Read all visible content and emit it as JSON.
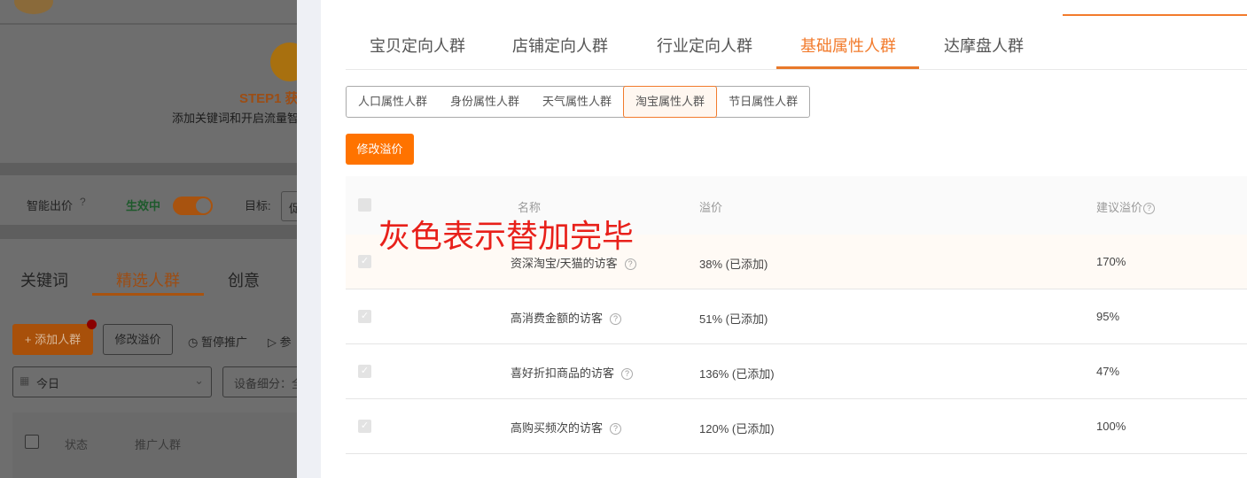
{
  "background": {
    "step_title": "STEP1 获",
    "step_desc": "添加关键词和开启流量智",
    "smart_bid_label": "智能出价",
    "status_label": "生效中",
    "target_label": "目标:",
    "target_value": "促",
    "tabs": [
      "关键词",
      "精选人群",
      "创意"
    ],
    "add_crowd_button": "+ 添加人群",
    "modify_premium_button": "修改溢价",
    "pause_label": "暂停推广",
    "resume_label": "参",
    "date_select": "今日",
    "device_select": "设备细分：全",
    "table_headers": [
      "状态",
      "推广人群"
    ]
  },
  "drawer": {
    "tabs": [
      "宝贝定向人群",
      "店铺定向人群",
      "行业定向人群",
      "基础属性人群",
      "达摩盘人群"
    ],
    "active_tab": 3,
    "segments": [
      "人口属性人群",
      "身份属性人群",
      "天气属性人群",
      "淘宝属性人群",
      "节日属性人群"
    ],
    "active_segment": 3,
    "modify_button": "修改溢价",
    "table": {
      "headers": [
        "名称",
        "溢价",
        "建议溢价"
      ],
      "rows": [
        {
          "name": "资深淘宝/天猫的访客",
          "premium": "38% (已添加)",
          "suggested": "170%"
        },
        {
          "name": "高消费金额的访客",
          "premium": "51% (已添加)",
          "suggested": "95%"
        },
        {
          "name": "喜好折扣商品的访客",
          "premium": "136% (已添加)",
          "suggested": "47%"
        },
        {
          "name": "高购买频次的访客",
          "premium": "120% (已添加)",
          "suggested": "100%"
        }
      ]
    },
    "annotation": "灰色表示替加完毕"
  },
  "colors": {
    "accent": "#ff7300",
    "annotation": "#e8201a",
    "status_green": "#2aa84a"
  }
}
